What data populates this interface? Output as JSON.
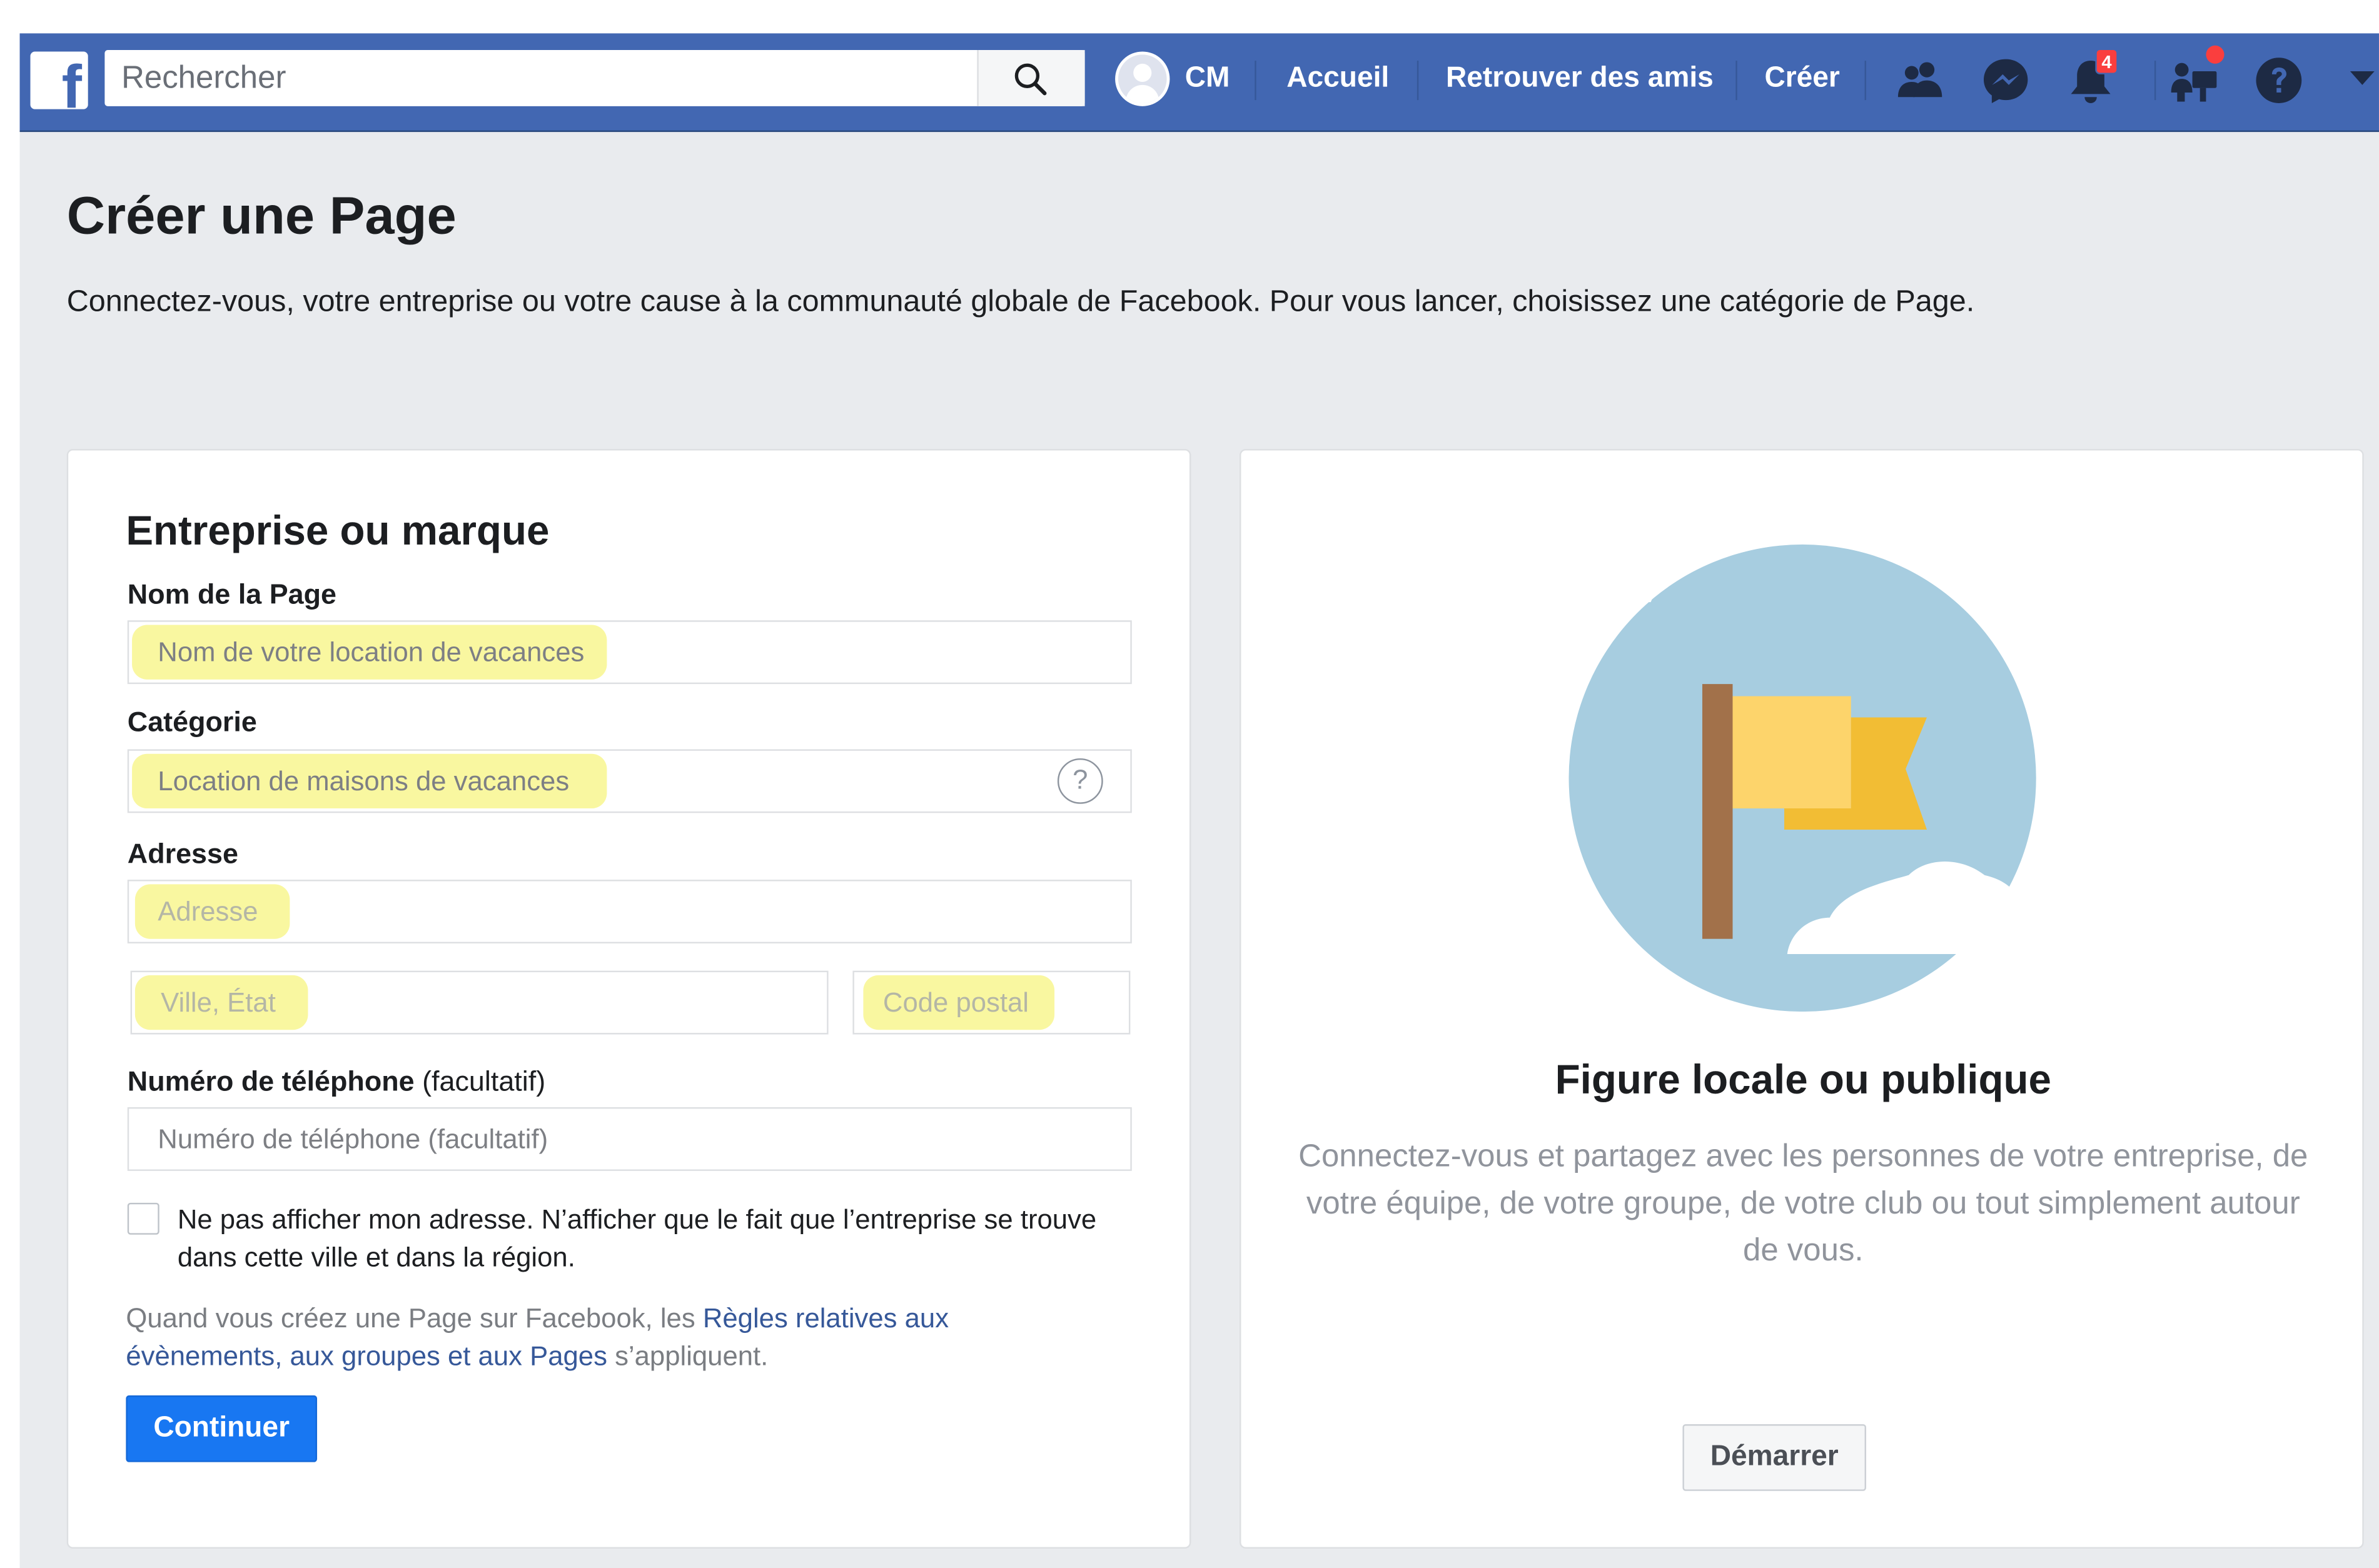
{
  "navbar": {
    "search_placeholder": "Rechercher",
    "profile_name": "CM",
    "links": [
      "Accueil",
      "Retrouver des amis",
      "Créer"
    ],
    "notification_count": "4",
    "brand_color": "#4267b2"
  },
  "page": {
    "title": "Créer une Page",
    "description": "Connectez-vous, votre entreprise ou votre cause à la communauté globale de Facebook. Pour vous lancer, choisissez une catégorie de Page."
  },
  "business_card": {
    "title": "Entreprise ou marque",
    "page_name_label": "Nom de la Page",
    "page_name_placeholder": "Nom de votre location de vacances",
    "category_label": "Catégorie",
    "category_placeholder": "Location de maisons de vacances",
    "category_help_glyph": "?",
    "address_label": "Adresse",
    "address_placeholder": "Adresse",
    "city_placeholder": "Ville, État",
    "postal_placeholder": "Code postal",
    "phone_label": "Numéro de téléphone",
    "phone_label_optional": "(facultatif)",
    "phone_placeholder": "Numéro de téléphone (facultatif)",
    "hide_address_checked": false,
    "hide_address_label": "Ne pas afficher mon adresse. N’afficher que le fait que l’entreprise se trouve dans cette ville et dans la région.",
    "rules_prefix": "Quand vous créez une Page sur Facebook, les",
    "rules_link": "Règles relatives aux évènements, aux groupes et aux Pages",
    "rules_suffix": "s’appliquent.",
    "continue_label": "Continuer",
    "highlight_color": "#f9f7a0"
  },
  "public_card": {
    "title": "Figure locale ou publique",
    "description": "Connectez-vous et partagez avec les personnes de votre entreprise, de votre équipe, de votre groupe, de votre club ou tout simplement autour de vous.",
    "start_label": "Démarrer",
    "icon": "flag-illustration"
  },
  "icons": [
    "facebook-logo",
    "search-icon",
    "friend-requests-icon",
    "messenger-icon",
    "notifications-icon",
    "quick-help-icon",
    "help-icon",
    "dropdown-arrow-icon"
  ]
}
